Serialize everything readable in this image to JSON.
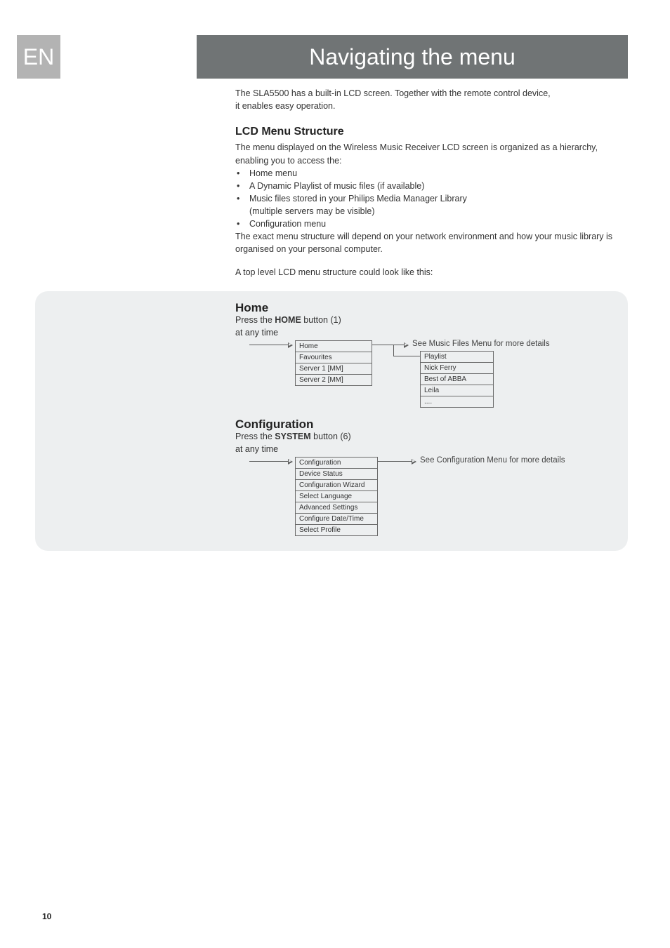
{
  "lang_badge": "EN",
  "title": "Navigating the menu",
  "intro_line1": "The SLA5500 has a built-in LCD screen. Together with the remote control device,",
  "intro_line2": " it enables easy operation.",
  "section1": {
    "heading": "LCD Menu Structure",
    "p1": "The menu displayed on the Wireless Music Receiver LCD screen is organized as a hierarchy, enabling you to access the:",
    "bullets": [
      "Home menu",
      "A Dynamic Playlist of music files (if available)",
      "Music files stored in your Philips Media Manager Library",
      "(multiple servers may be visible)",
      "Configuration menu"
    ],
    "p2": "The exact menu structure will depend on your network environment and how your music library is organised on your personal computer.",
    "p3": "A top level LCD menu structure could look like this:"
  },
  "panel": {
    "home": {
      "heading": "Home",
      "press_pre": "Press the ",
      "press_bold": "HOME",
      "press_post": " button (1)",
      "anytime": "at any time",
      "menu": [
        "Home",
        "Favourites",
        "Server 1 [MM]",
        "Server 2 [MM]"
      ],
      "submenu": [
        "Playlist",
        "Nick Ferry",
        "Best of ABBA",
        "Leila",
        "...."
      ],
      "ref": "See Music Files Menu for more details"
    },
    "config": {
      "heading": "Configuration",
      "press_pre": "Press the ",
      "press_bold": "SYSTEM",
      "press_post": " button (6)",
      "anytime": "at any time",
      "menu": [
        "Configuration",
        "Device Status",
        "Configuration Wizard",
        "Select Language",
        "Advanced Settings",
        "Configure Date/Time",
        "Select Profile"
      ],
      "ref": "See Configuration Menu for more details"
    }
  },
  "page_number": "10"
}
